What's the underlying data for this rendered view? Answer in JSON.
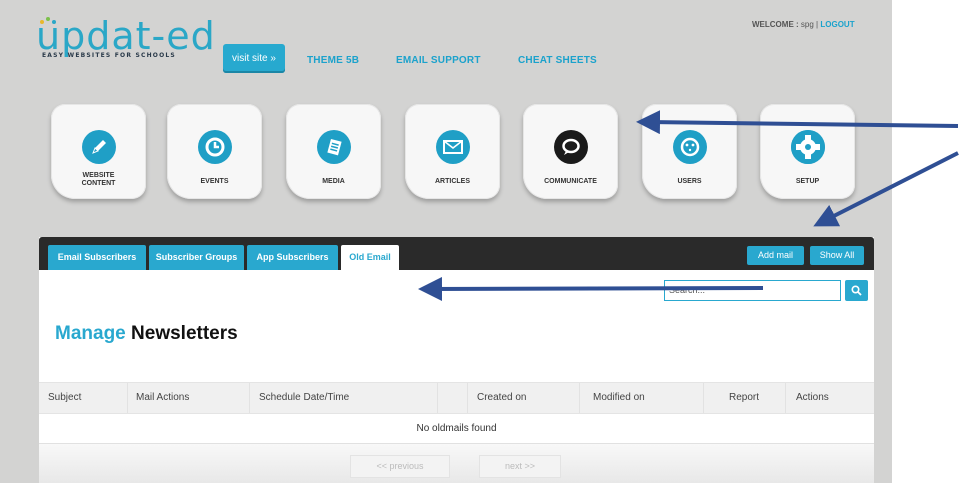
{
  "brand": {
    "logo_text": "updat-ed",
    "tagline": "EASY WEBSITES FOR SCHOOLS"
  },
  "header": {
    "visit_site": "visit site »",
    "nav": [
      "THEME 5B",
      "EMAIL SUPPORT",
      "CHEAT SHEETS"
    ],
    "welcome_label": "WELCOME :",
    "username": "spg",
    "separator": "|",
    "logout": "LOGOUT"
  },
  "tiles": [
    {
      "label": "WEBSITE CONTENT",
      "line1": "WEBSITE",
      "line2": "CONTENT",
      "icon": "pencil-icon"
    },
    {
      "label": "EVENTS",
      "icon": "clock-icon"
    },
    {
      "label": "MEDIA",
      "icon": "document-icon"
    },
    {
      "label": "ARTICLES",
      "icon": "envelope-icon"
    },
    {
      "label": "COMMUNICATE",
      "icon": "speech-bubble-icon"
    },
    {
      "label": "USERS",
      "icon": "user-face-icon"
    },
    {
      "label": "SETUP",
      "icon": "gear-icon"
    }
  ],
  "panel": {
    "tabs": [
      "Email Subscribers",
      "Subscriber Groups",
      "App Subscribers",
      "Old Email"
    ],
    "active_tab": "Old Email",
    "actions": {
      "add_mail": "Add mail",
      "show_all": "Show All"
    },
    "search_placeholder": "Search...",
    "heading_accent": "Manage",
    "heading_rest": "Newsletters",
    "columns": [
      "Subject",
      "Mail Actions",
      "Schedule Date/Time",
      "Created on",
      "Modified on",
      "Report",
      "Actions"
    ],
    "empty_message": "No oldmails found",
    "pager": {
      "previous": "<< previous",
      "next": "next >>"
    }
  },
  "colors": {
    "accent": "#29a8cf",
    "panel_bar": "#2a2a2a",
    "background": "#d3d3d2",
    "annotation_arrow": "#2f4f94"
  }
}
